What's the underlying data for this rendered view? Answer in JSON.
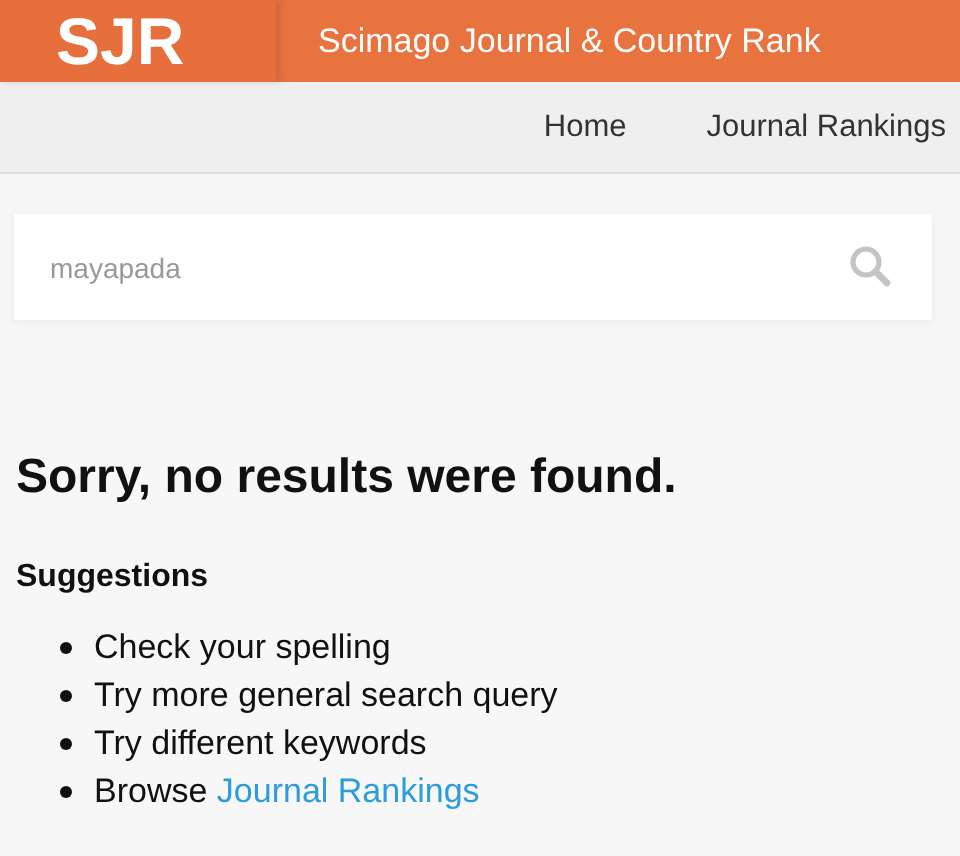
{
  "header": {
    "logo": "SJR",
    "title": "Scimago Journal & Country Rank"
  },
  "nav": [
    {
      "label": "Home"
    },
    {
      "label": "Journal Rankings"
    }
  ],
  "search": {
    "value": "mayapada"
  },
  "message": "Sorry, no results were found.",
  "suggestions": {
    "title": "Suggestions",
    "items": [
      {
        "text": "Check your spelling"
      },
      {
        "text": "Try more general search query"
      },
      {
        "text": "Try different keywords"
      },
      {
        "text": "Browse",
        "link": "Journal Rankings"
      }
    ]
  }
}
